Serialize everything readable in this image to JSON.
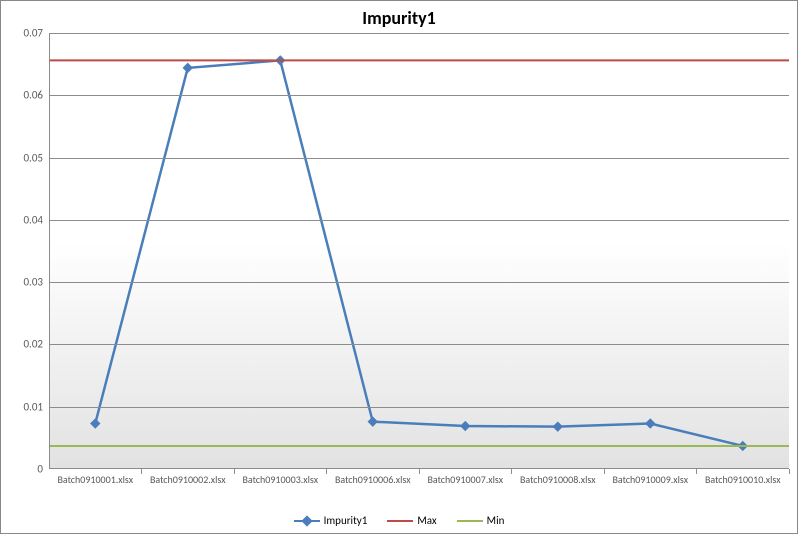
{
  "chart_data": {
    "type": "line",
    "title": "Impurity1",
    "xlabel": "",
    "ylabel": "",
    "ylim": [
      0,
      0.07
    ],
    "y_ticks": [
      0,
      0.01,
      0.02,
      0.03,
      0.04,
      0.05,
      0.06,
      0.07
    ],
    "categories": [
      "Batch0910001.xlsx",
      "Batch0910002.xlsx",
      "Batch0910003.xlsx",
      "Batch0910006.xlsx",
      "Batch0910007.xlsx",
      "Batch0910008.xlsx",
      "Batch0910009.xlsx",
      "Batch0910010.xlsx"
    ],
    "series": [
      {
        "name": "Impurity1",
        "color": "#4a7ebb",
        "marker": "diamond",
        "values": [
          0.0073,
          0.0644,
          0.0656,
          0.0076,
          0.0069,
          0.0068,
          0.0073,
          0.0037
        ]
      },
      {
        "name": "Max",
        "color": "#be4b48",
        "marker": "none",
        "values": [
          0.0656,
          0.0656,
          0.0656,
          0.0656,
          0.0656,
          0.0656,
          0.0656,
          0.0656
        ]
      },
      {
        "name": "Min",
        "color": "#98b954",
        "marker": "none",
        "values": [
          0.0037,
          0.0037,
          0.0037,
          0.0037,
          0.0037,
          0.0037,
          0.0037,
          0.0037
        ]
      }
    ],
    "legend_position": "bottom"
  }
}
